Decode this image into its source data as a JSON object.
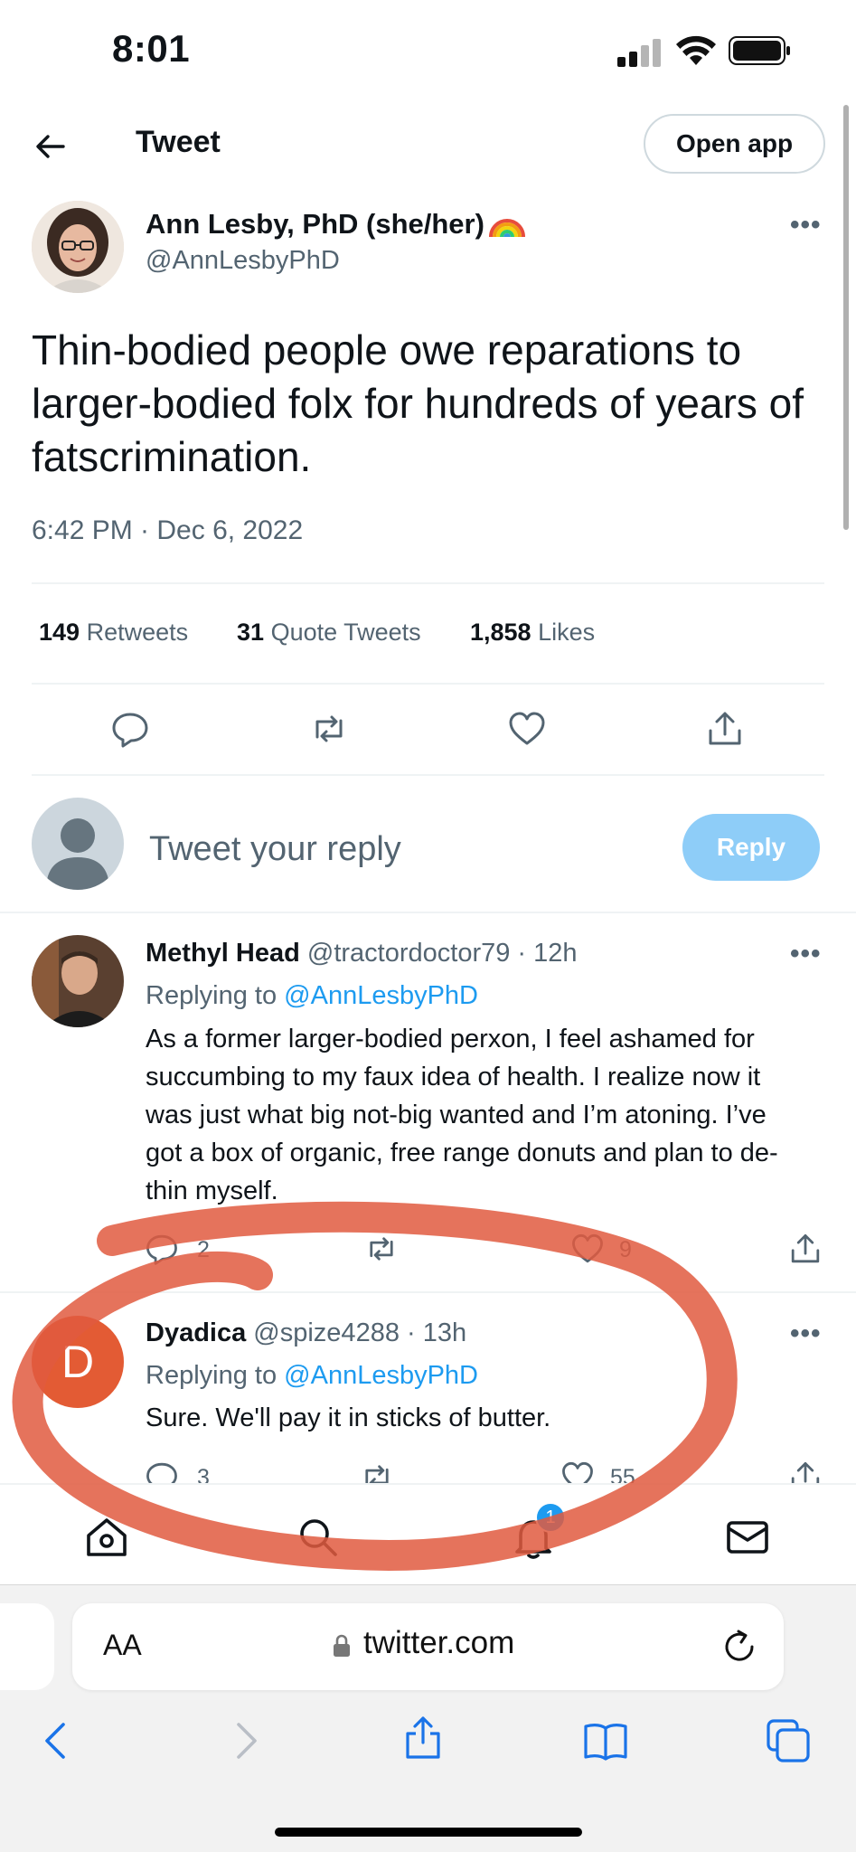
{
  "status_bar": {
    "time": "8:01"
  },
  "nav": {
    "title": "Tweet",
    "open_app_label": "Open app"
  },
  "tweet": {
    "author_name": "Ann Lesby, PhD (she/her)",
    "author_handle": "@AnnLesbyPhD",
    "text": "Thin-bodied people owe reparations to larger-bodied folx for hundreds of years of fatscrimination.",
    "timestamp": "6:42 PM · Dec 6, 2022",
    "stats": [
      {
        "count": "149",
        "label": "Retweets"
      },
      {
        "count": "31",
        "label": "Quote Tweets"
      },
      {
        "count": "1,858",
        "label": "Likes"
      }
    ]
  },
  "composer": {
    "placeholder": "Tweet your reply",
    "reply_label": "Reply"
  },
  "replies": [
    {
      "name": "Methyl Head",
      "handle": "@tractordoctor79",
      "time": "12h",
      "replying_prefix": "Replying to",
      "replying_to": "@AnnLesbyPhD",
      "text_lines": [
        "As a former larger-bodied perxon, I feel ashamed for",
        "succumbing to my faux idea of health. I realize now it",
        "was just what big not-big wanted and I’m atoning. I’ve",
        "got a box of organic, free range donuts and plan to de-",
        "thin myself."
      ],
      "reply_count": "2",
      "like_count": "9"
    },
    {
      "name": "Dyadica",
      "handle": "@spize4288",
      "time": "13h",
      "avatar_letter": "D",
      "replying_prefix": "Replying to",
      "replying_to": "@AnnLesbyPhD",
      "text": "Sure. We'll pay it in sticks of butter.",
      "reply_count": "3",
      "like_count": "55"
    }
  ],
  "bottom_nav": {
    "notification_badge": "1",
    "icons": [
      "home-icon",
      "search-icon",
      "notifications-icon",
      "messages-icon"
    ]
  },
  "safari": {
    "text_size_label": "AA",
    "url": "twitter.com"
  },
  "colors": {
    "link": "#1d9bf0",
    "reply_button": "#8ecdf8",
    "annotation_circle": "#e05a40",
    "secondary_text": "#536471"
  }
}
